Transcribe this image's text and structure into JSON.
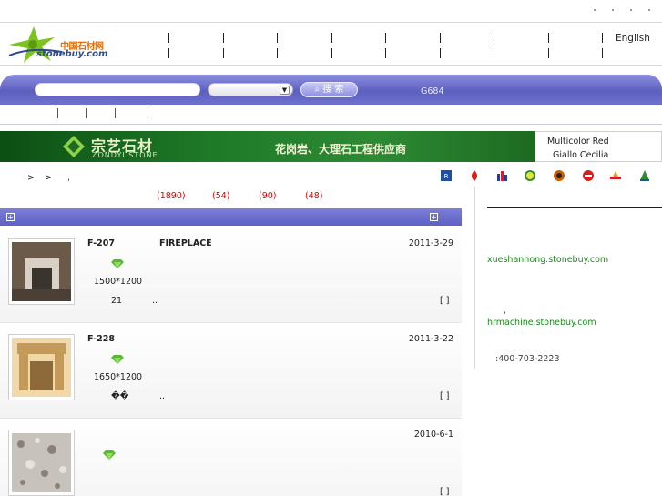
{
  "header": {
    "logo": {
      "name": "logo-icon",
      "brand_cn": "中国石材网",
      "brand_en": "stonebuy.com"
    },
    "language_link": "English"
  },
  "search": {
    "input_value": "",
    "select_value": "",
    "button_label": "搜 索",
    "hot_keyword": "G684"
  },
  "banner": {
    "company_cn": "宗艺石材",
    "company_en": "ZONDYI STONE",
    "slogan": "花岗岩、大理石工程供应商"
  },
  "banner_side": {
    "line1": "Multicolor Red",
    "line2": "Giallo Cecilia"
  },
  "breadcrumb": {
    "sep1": ">",
    "sep2": ">",
    "current": ","
  },
  "cert_icons": [
    {
      "name": "cert-icon-1",
      "color": "#1f4fa0"
    },
    {
      "name": "cert-icon-2",
      "color": "#d42020"
    },
    {
      "name": "cert-icon-3",
      "color": "#2a3c9a"
    },
    {
      "name": "cert-icon-4",
      "color": "#2f8f2f"
    },
    {
      "name": "cert-icon-5",
      "color": "#c95f00"
    },
    {
      "name": "cert-icon-6",
      "color": "#d42020"
    },
    {
      "name": "cert-icon-7",
      "color": "#d42020"
    },
    {
      "name": "cert-icon-8",
      "color": "#2f8f2f"
    }
  ],
  "counts": [
    "(1890)",
    "(54)",
    "(90)",
    "(48)"
  ],
  "list_header": {
    "left_icon": "plus-box-icon",
    "right_icon": "plus-box-icon"
  },
  "items": [
    {
      "code": "F-207",
      "tag": "FIREPLACE",
      "date": "2011-3-29",
      "size": "1500*1200",
      "note_a": "21",
      "note_b": "..",
      "brackets": "[ ]",
      "thumb_colors": [
        "#6b5a4a",
        "#d8d0c4",
        "#3a342e"
      ]
    },
    {
      "code": "F-228",
      "tag": "",
      "date": "2011-3-22",
      "size": "1650*1200",
      "note_a": "��",
      "note_b": "..",
      "brackets": "[ ]",
      "thumb_colors": [
        "#c49a5a",
        "#f0d8a8",
        "#8e6a3a"
      ]
    },
    {
      "code": "",
      "tag": "",
      "date": "2010-6-1",
      "size": "",
      "note_a": "",
      "note_b": "",
      "brackets": "[ ]",
      "thumb_colors": [
        "#c8c2bc",
        "#e6e2dc",
        "#8a8078"
      ]
    }
  ],
  "right_sidebar": {
    "link1": "xueshanhong.stonebuy.com",
    "mark": ",",
    "link2": "hrmachine.stonebuy.com",
    "phone": ":400-703-2223"
  }
}
